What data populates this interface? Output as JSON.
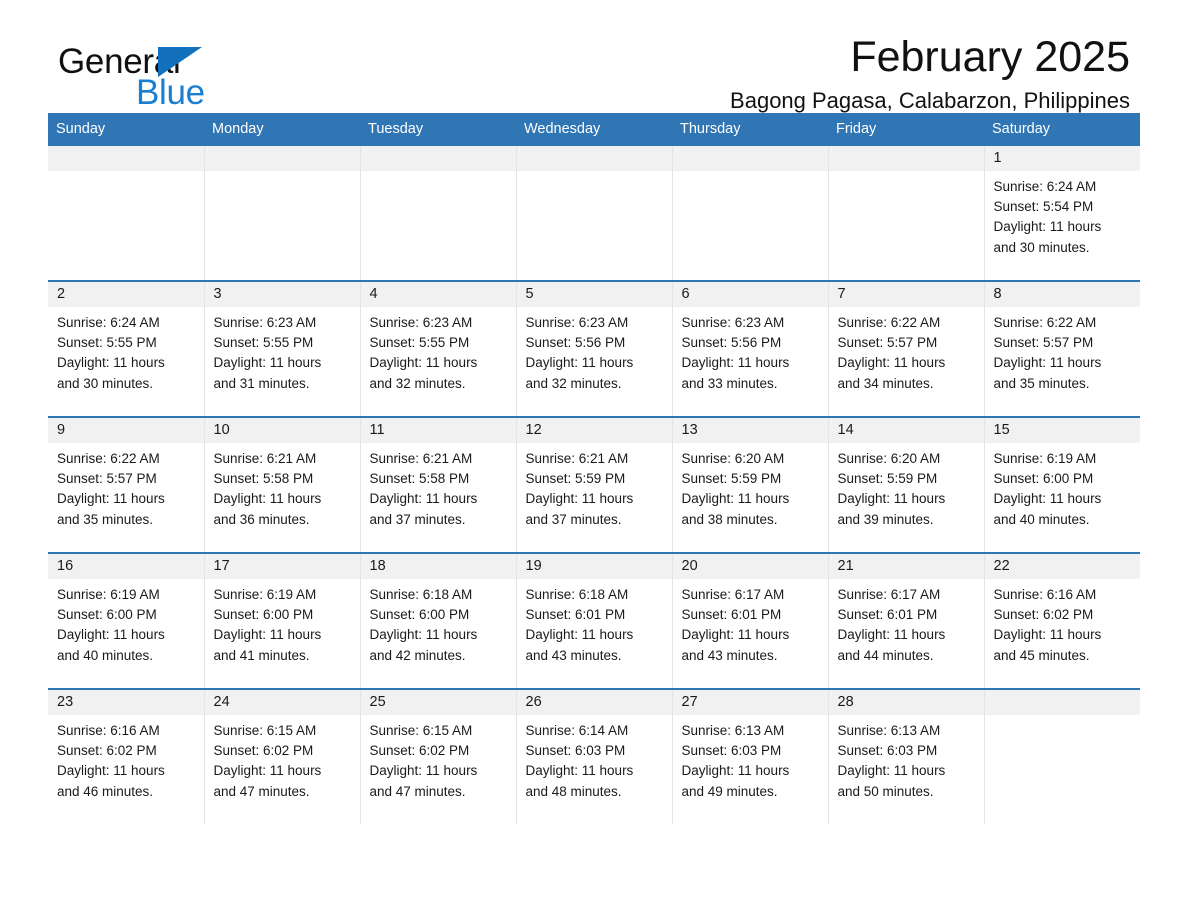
{
  "brand": {
    "name_part1": "General",
    "name_part2": "Blue",
    "triangle_color": "#1270bd",
    "blue_text_color": "#1b7fd1"
  },
  "header": {
    "title": "February 2025",
    "location": "Bagong Pagasa, Calabarzon, Philippines",
    "accent_color": "#3075b4",
    "daynum_band_color": "#f1f1f1"
  },
  "weekday_headers": [
    "Sunday",
    "Monday",
    "Tuesday",
    "Wednesday",
    "Thursday",
    "Friday",
    "Saturday"
  ],
  "weeks": [
    [
      {
        "day": "",
        "sunrise": "",
        "sunset": "",
        "daylight_line1": "",
        "daylight_line2": "",
        "empty": true
      },
      {
        "day": "",
        "sunrise": "",
        "sunset": "",
        "daylight_line1": "",
        "daylight_line2": "",
        "empty": true
      },
      {
        "day": "",
        "sunrise": "",
        "sunset": "",
        "daylight_line1": "",
        "daylight_line2": "",
        "empty": true
      },
      {
        "day": "",
        "sunrise": "",
        "sunset": "",
        "daylight_line1": "",
        "daylight_line2": "",
        "empty": true
      },
      {
        "day": "",
        "sunrise": "",
        "sunset": "",
        "daylight_line1": "",
        "daylight_line2": "",
        "empty": true
      },
      {
        "day": "",
        "sunrise": "",
        "sunset": "",
        "daylight_line1": "",
        "daylight_line2": "",
        "empty": true
      },
      {
        "day": "1",
        "sunrise": "Sunrise: 6:24 AM",
        "sunset": "Sunset: 5:54 PM",
        "daylight_line1": "Daylight: 11 hours",
        "daylight_line2": "and 30 minutes.",
        "empty": false
      }
    ],
    [
      {
        "day": "2",
        "sunrise": "Sunrise: 6:24 AM",
        "sunset": "Sunset: 5:55 PM",
        "daylight_line1": "Daylight: 11 hours",
        "daylight_line2": "and 30 minutes.",
        "empty": false
      },
      {
        "day": "3",
        "sunrise": "Sunrise: 6:23 AM",
        "sunset": "Sunset: 5:55 PM",
        "daylight_line1": "Daylight: 11 hours",
        "daylight_line2": "and 31 minutes.",
        "empty": false
      },
      {
        "day": "4",
        "sunrise": "Sunrise: 6:23 AM",
        "sunset": "Sunset: 5:55 PM",
        "daylight_line1": "Daylight: 11 hours",
        "daylight_line2": "and 32 minutes.",
        "empty": false
      },
      {
        "day": "5",
        "sunrise": "Sunrise: 6:23 AM",
        "sunset": "Sunset: 5:56 PM",
        "daylight_line1": "Daylight: 11 hours",
        "daylight_line2": "and 32 minutes.",
        "empty": false
      },
      {
        "day": "6",
        "sunrise": "Sunrise: 6:23 AM",
        "sunset": "Sunset: 5:56 PM",
        "daylight_line1": "Daylight: 11 hours",
        "daylight_line2": "and 33 minutes.",
        "empty": false
      },
      {
        "day": "7",
        "sunrise": "Sunrise: 6:22 AM",
        "sunset": "Sunset: 5:57 PM",
        "daylight_line1": "Daylight: 11 hours",
        "daylight_line2": "and 34 minutes.",
        "empty": false
      },
      {
        "day": "8",
        "sunrise": "Sunrise: 6:22 AM",
        "sunset": "Sunset: 5:57 PM",
        "daylight_line1": "Daylight: 11 hours",
        "daylight_line2": "and 35 minutes.",
        "empty": false
      }
    ],
    [
      {
        "day": "9",
        "sunrise": "Sunrise: 6:22 AM",
        "sunset": "Sunset: 5:57 PM",
        "daylight_line1": "Daylight: 11 hours",
        "daylight_line2": "and 35 minutes.",
        "empty": false
      },
      {
        "day": "10",
        "sunrise": "Sunrise: 6:21 AM",
        "sunset": "Sunset: 5:58 PM",
        "daylight_line1": "Daylight: 11 hours",
        "daylight_line2": "and 36 minutes.",
        "empty": false
      },
      {
        "day": "11",
        "sunrise": "Sunrise: 6:21 AM",
        "sunset": "Sunset: 5:58 PM",
        "daylight_line1": "Daylight: 11 hours",
        "daylight_line2": "and 37 minutes.",
        "empty": false
      },
      {
        "day": "12",
        "sunrise": "Sunrise: 6:21 AM",
        "sunset": "Sunset: 5:59 PM",
        "daylight_line1": "Daylight: 11 hours",
        "daylight_line2": "and 37 minutes.",
        "empty": false
      },
      {
        "day": "13",
        "sunrise": "Sunrise: 6:20 AM",
        "sunset": "Sunset: 5:59 PM",
        "daylight_line1": "Daylight: 11 hours",
        "daylight_line2": "and 38 minutes.",
        "empty": false
      },
      {
        "day": "14",
        "sunrise": "Sunrise: 6:20 AM",
        "sunset": "Sunset: 5:59 PM",
        "daylight_line1": "Daylight: 11 hours",
        "daylight_line2": "and 39 minutes.",
        "empty": false
      },
      {
        "day": "15",
        "sunrise": "Sunrise: 6:19 AM",
        "sunset": "Sunset: 6:00 PM",
        "daylight_line1": "Daylight: 11 hours",
        "daylight_line2": "and 40 minutes.",
        "empty": false
      }
    ],
    [
      {
        "day": "16",
        "sunrise": "Sunrise: 6:19 AM",
        "sunset": "Sunset: 6:00 PM",
        "daylight_line1": "Daylight: 11 hours",
        "daylight_line2": "and 40 minutes.",
        "empty": false
      },
      {
        "day": "17",
        "sunrise": "Sunrise: 6:19 AM",
        "sunset": "Sunset: 6:00 PM",
        "daylight_line1": "Daylight: 11 hours",
        "daylight_line2": "and 41 minutes.",
        "empty": false
      },
      {
        "day": "18",
        "sunrise": "Sunrise: 6:18 AM",
        "sunset": "Sunset: 6:00 PM",
        "daylight_line1": "Daylight: 11 hours",
        "daylight_line2": "and 42 minutes.",
        "empty": false
      },
      {
        "day": "19",
        "sunrise": "Sunrise: 6:18 AM",
        "sunset": "Sunset: 6:01 PM",
        "daylight_line1": "Daylight: 11 hours",
        "daylight_line2": "and 43 minutes.",
        "empty": false
      },
      {
        "day": "20",
        "sunrise": "Sunrise: 6:17 AM",
        "sunset": "Sunset: 6:01 PM",
        "daylight_line1": "Daylight: 11 hours",
        "daylight_line2": "and 43 minutes.",
        "empty": false
      },
      {
        "day": "21",
        "sunrise": "Sunrise: 6:17 AM",
        "sunset": "Sunset: 6:01 PM",
        "daylight_line1": "Daylight: 11 hours",
        "daylight_line2": "and 44 minutes.",
        "empty": false
      },
      {
        "day": "22",
        "sunrise": "Sunrise: 6:16 AM",
        "sunset": "Sunset: 6:02 PM",
        "daylight_line1": "Daylight: 11 hours",
        "daylight_line2": "and 45 minutes.",
        "empty": false
      }
    ],
    [
      {
        "day": "23",
        "sunrise": "Sunrise: 6:16 AM",
        "sunset": "Sunset: 6:02 PM",
        "daylight_line1": "Daylight: 11 hours",
        "daylight_line2": "and 46 minutes.",
        "empty": false
      },
      {
        "day": "24",
        "sunrise": "Sunrise: 6:15 AM",
        "sunset": "Sunset: 6:02 PM",
        "daylight_line1": "Daylight: 11 hours",
        "daylight_line2": "and 47 minutes.",
        "empty": false
      },
      {
        "day": "25",
        "sunrise": "Sunrise: 6:15 AM",
        "sunset": "Sunset: 6:02 PM",
        "daylight_line1": "Daylight: 11 hours",
        "daylight_line2": "and 47 minutes.",
        "empty": false
      },
      {
        "day": "26",
        "sunrise": "Sunrise: 6:14 AM",
        "sunset": "Sunset: 6:03 PM",
        "daylight_line1": "Daylight: 11 hours",
        "daylight_line2": "and 48 minutes.",
        "empty": false
      },
      {
        "day": "27",
        "sunrise": "Sunrise: 6:13 AM",
        "sunset": "Sunset: 6:03 PM",
        "daylight_line1": "Daylight: 11 hours",
        "daylight_line2": "and 49 minutes.",
        "empty": false
      },
      {
        "day": "28",
        "sunrise": "Sunrise: 6:13 AM",
        "sunset": "Sunset: 6:03 PM",
        "daylight_line1": "Daylight: 11 hours",
        "daylight_line2": "and 50 minutes.",
        "empty": false
      },
      {
        "day": "",
        "sunrise": "",
        "sunset": "",
        "daylight_line1": "",
        "daylight_line2": "",
        "empty": true
      }
    ]
  ]
}
